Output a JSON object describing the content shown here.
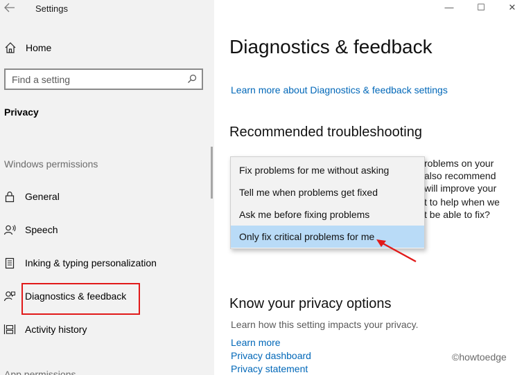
{
  "window": {
    "title": "Settings",
    "controls": {
      "minimize": "—",
      "maximize": "☐",
      "close": "✕"
    }
  },
  "sidebar": {
    "home_label": "Home",
    "search": {
      "placeholder": "Find a setting"
    },
    "section_label": "Privacy",
    "group_label": "Windows permissions",
    "group_label_2": "App permissions",
    "items": [
      {
        "label": "General",
        "icon": "lock-icon"
      },
      {
        "label": "Speech",
        "icon": "speech-icon"
      },
      {
        "label": "Inking & typing personalization",
        "icon": "clipboard-icon"
      },
      {
        "label": "Diagnostics & feedback",
        "icon": "feedback-icon"
      },
      {
        "label": "Activity history",
        "icon": "timeline-icon"
      }
    ]
  },
  "main": {
    "title": "Diagnostics & feedback",
    "learn_more_top": "Learn more about Diagnostics & feedback settings",
    "recommended_title": "Recommended troubleshooting",
    "partial_text": [
      "roblems on your",
      "also recommend",
      "will improve your",
      "t to help when we",
      "t be able to fix?"
    ],
    "dropdown": {
      "options": [
        "Fix problems for me without asking",
        "Tell me when problems get fixed",
        "Ask me before fixing problems",
        "Only fix critical problems for me"
      ],
      "selected_index": 3
    },
    "privacy_title": "Know your privacy options",
    "privacy_desc": "Learn how this setting impacts your privacy.",
    "privacy_links": [
      "Learn more",
      "Privacy dashboard",
      "Privacy statement"
    ]
  },
  "watermark": "©howtoedge",
  "colors": {
    "sidebar_bg": "#f2f2f2",
    "link": "#0067b8",
    "selected_option": "#b9dbf7",
    "annotation_red": "#e11919"
  }
}
